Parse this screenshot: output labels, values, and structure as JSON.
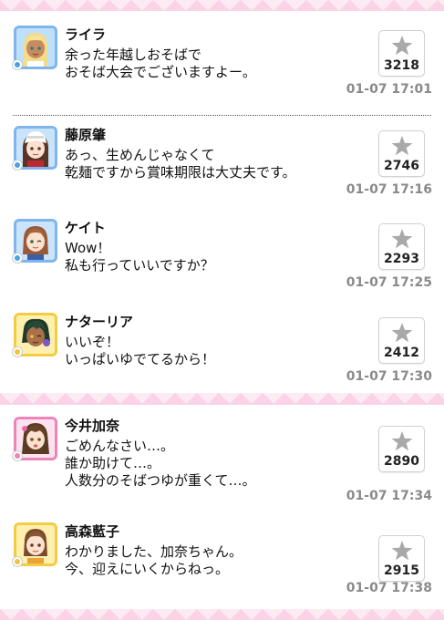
{
  "colors": {
    "band_pink": "#fbd3e6",
    "timestamp_gray": "#8a8a8a",
    "star_gray": "#a9a9a9",
    "cute_type": "#ec84b9",
    "cool_type": "#4aa3ea",
    "passion_type": "#f2c23a"
  },
  "icons": {
    "like": "star-icon"
  },
  "posts": [
    {
      "name": "ライラ",
      "lines": [
        "余った年越しおそばで",
        "おそば大会でございますよー。"
      ],
      "likes": "3218",
      "time": "01-07 17:01",
      "type": "cool"
    },
    {
      "name": "藤原肇",
      "lines": [
        "あっ、生めんじゃなくて",
        "乾麺ですから賞味期限は大丈夫です。"
      ],
      "likes": "2746",
      "time": "01-07 17:16",
      "type": "cool"
    },
    {
      "name": "ケイト",
      "lines": [
        "Wow！",
        "私も行っていいですか？"
      ],
      "likes": "2293",
      "time": "01-07 17:25",
      "type": "cool"
    },
    {
      "name": "ナターリア",
      "lines": [
        "いいぞ！",
        "いっぱいゆでてるから！"
      ],
      "likes": "2412",
      "time": "01-07 17:30",
      "type": "passion"
    },
    {
      "name": "今井加奈",
      "lines": [
        "ごめんなさい…。",
        "誰か助けて…。",
        "人数分のそばつゆが重くて…。"
      ],
      "likes": "2890",
      "time": "01-07 17:34",
      "type": "cute"
    },
    {
      "name": "高森藍子",
      "lines": [
        "わかりました、加奈ちゃん。",
        "今、迎えにいくからねっ。"
      ],
      "likes": "2915",
      "time": "01-07 17:38",
      "type": "passion"
    }
  ]
}
